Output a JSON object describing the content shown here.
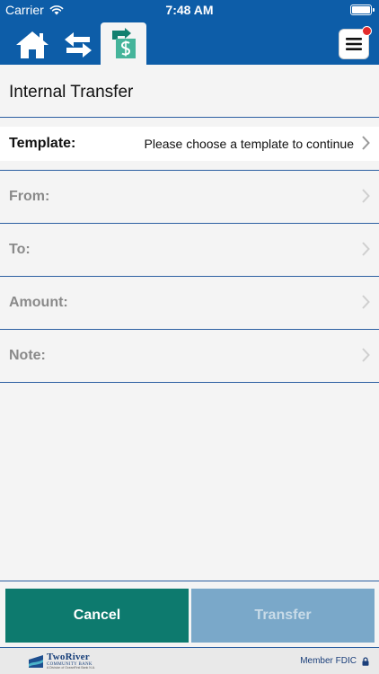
{
  "status_bar": {
    "carrier": "Carrier",
    "time": "7:48 AM",
    "icons": [
      "wifi-icon",
      "battery-icon"
    ]
  },
  "nav": {
    "tabs": [
      {
        "name": "home",
        "icon": "home-icon"
      },
      {
        "name": "transfer-arrows",
        "icon": "swap-arrows-icon"
      },
      {
        "name": "internal-transfer",
        "icon": "transfer-dollar-icon",
        "active": true
      }
    ],
    "menu_icon": "hamburger-menu-icon",
    "notification_color": "#e32a2a"
  },
  "page": {
    "title": "Internal Transfer"
  },
  "form": {
    "template": {
      "label": "Template:",
      "value": "Please choose a template to continue"
    },
    "from": {
      "label": "From:"
    },
    "to": {
      "label": "To:"
    },
    "amount": {
      "label": "Amount:"
    },
    "note": {
      "label": "Note:"
    }
  },
  "actions": {
    "cancel_label": "Cancel",
    "transfer_label": "Transfer"
  },
  "footer": {
    "logo": {
      "line1": "TwoRiver",
      "line2": "COMMUNITY BANK",
      "line3": "A Division of OceanFirst Bank N.A."
    },
    "fdic_label": "Member FDIC",
    "fdic_icon": "lock-icon"
  },
  "colors": {
    "brand_blue": "#0d5da8",
    "accent_teal": "#0d7a6e",
    "transfer_disabled": "#7aa8c9",
    "divider": "#2c5fa1"
  }
}
